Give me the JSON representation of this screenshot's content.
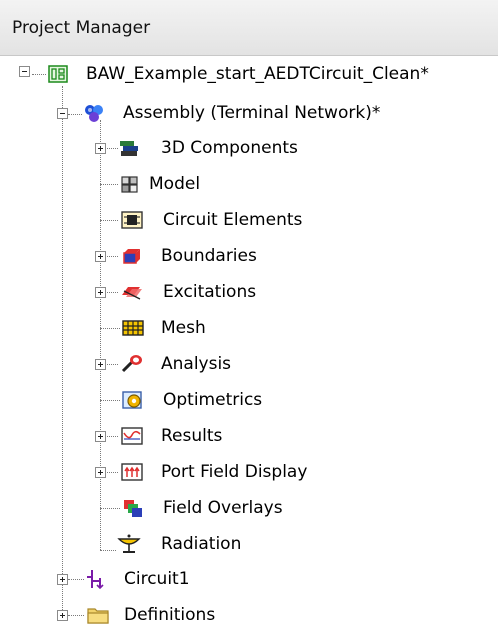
{
  "panel": {
    "title": "Project Manager"
  },
  "tree": {
    "project": {
      "label": "BAW_Example_start_AEDTCircuit_Clean*",
      "icon": "project-icon",
      "expanded": true
    },
    "design": {
      "label": "Assembly (Terminal Network)*",
      "icon": "assembly-icon",
      "expanded": true
    },
    "children": [
      {
        "label": "3D Components",
        "icon": "3d-components-icon",
        "expandable": true
      },
      {
        "label": "Model",
        "icon": "model-icon",
        "expandable": false
      },
      {
        "label": "Circuit Elements",
        "icon": "circuit-elements-icon",
        "expandable": false
      },
      {
        "label": "Boundaries",
        "icon": "boundaries-icon",
        "expandable": true
      },
      {
        "label": "Excitations",
        "icon": "excitations-icon",
        "expandable": true
      },
      {
        "label": "Mesh",
        "icon": "mesh-icon",
        "expandable": false
      },
      {
        "label": "Analysis",
        "icon": "analysis-icon",
        "expandable": true
      },
      {
        "label": "Optimetrics",
        "icon": "optimetrics-icon",
        "expandable": false
      },
      {
        "label": "Results",
        "icon": "results-icon",
        "expandable": true
      },
      {
        "label": "Port Field Display",
        "icon": "port-field-display-icon",
        "expandable": true
      },
      {
        "label": "Field Overlays",
        "icon": "field-overlays-icon",
        "expandable": false
      },
      {
        "label": "Radiation",
        "icon": "radiation-icon",
        "expandable": false
      }
    ],
    "siblings": [
      {
        "label": "Circuit1",
        "icon": "circuit-icon",
        "expandable": true
      },
      {
        "label": "Definitions",
        "icon": "folder-icon",
        "expandable": true
      }
    ]
  }
}
